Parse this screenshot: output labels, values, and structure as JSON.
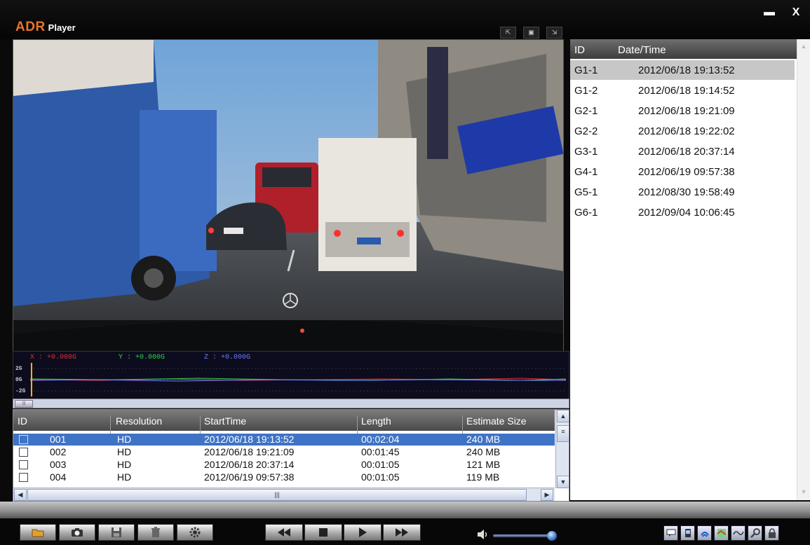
{
  "app": {
    "brand": "ADR",
    "subtitle": "Player"
  },
  "window": {
    "minimize_glyph": "▬",
    "close_glyph": "X"
  },
  "layout_buttons": [
    "layout-icon-1",
    "layout-icon-2",
    "layout-icon-3"
  ],
  "gsensor": {
    "x_label": "X : +0.000G",
    "y_label": "Y : +0.000G",
    "z_label": "Z : +0.000G",
    "ticks": [
      "2G",
      "0G",
      "-2G"
    ],
    "colors": {
      "x": "#e0302a",
      "y": "#33d44a",
      "z": "#6a7bff"
    }
  },
  "clip_table": {
    "columns": [
      "ID",
      "Resolution",
      "StartTime",
      "Length",
      "Estimate Size"
    ],
    "rows": [
      {
        "id": "001",
        "resolution": "HD",
        "start": "2012/06/18 19:13:52",
        "length": "00:02:04",
        "size": "240 MB",
        "selected": true
      },
      {
        "id": "002",
        "resolution": "HD",
        "start": "2012/06/18 19:21:09",
        "length": "00:01:45",
        "size": "240 MB",
        "selected": false
      },
      {
        "id": "003",
        "resolution": "HD",
        "start": "2012/06/18 20:37:14",
        "length": "00:01:05",
        "size": "121 MB",
        "selected": false
      },
      {
        "id": "004",
        "resolution": "HD",
        "start": "2012/06/19 09:57:38",
        "length": "00:01:05",
        "size": "119 MB",
        "selected": false
      }
    ]
  },
  "event_list": {
    "columns": [
      "ID",
      "Date/Time"
    ],
    "rows": [
      {
        "id": "G1-1",
        "datetime": "2012/06/18 19:13:52",
        "selected": true
      },
      {
        "id": "G1-2",
        "datetime": "2012/06/18 19:14:52",
        "selected": false
      },
      {
        "id": "G2-1",
        "datetime": "2012/06/18 19:21:09",
        "selected": false
      },
      {
        "id": "G2-2",
        "datetime": "2012/06/18 19:22:02",
        "selected": false
      },
      {
        "id": "G3-1",
        "datetime": "2012/06/18 20:37:14",
        "selected": false
      },
      {
        "id": "G4-1",
        "datetime": "2012/06/19 09:57:38",
        "selected": false
      },
      {
        "id": "G5-1",
        "datetime": "2012/08/30 19:58:49",
        "selected": false
      },
      {
        "id": "G6-1",
        "datetime": "2012/09/04 10:06:45",
        "selected": false
      }
    ]
  },
  "controls": {
    "file_buttons": [
      "folder-icon",
      "camera-icon",
      "save-icon",
      "trash-icon",
      "gear-icon"
    ],
    "playback_buttons": [
      "rewind-icon",
      "stop-icon",
      "play-icon",
      "fast-forward-icon"
    ],
    "volume_level": 0.9,
    "tool_buttons": [
      "chat-icon",
      "gps-icon",
      "signal-icon",
      "map-icon",
      "graph-icon",
      "search-icon",
      "lock-icon"
    ],
    "accent": "#2f6bc0"
  }
}
